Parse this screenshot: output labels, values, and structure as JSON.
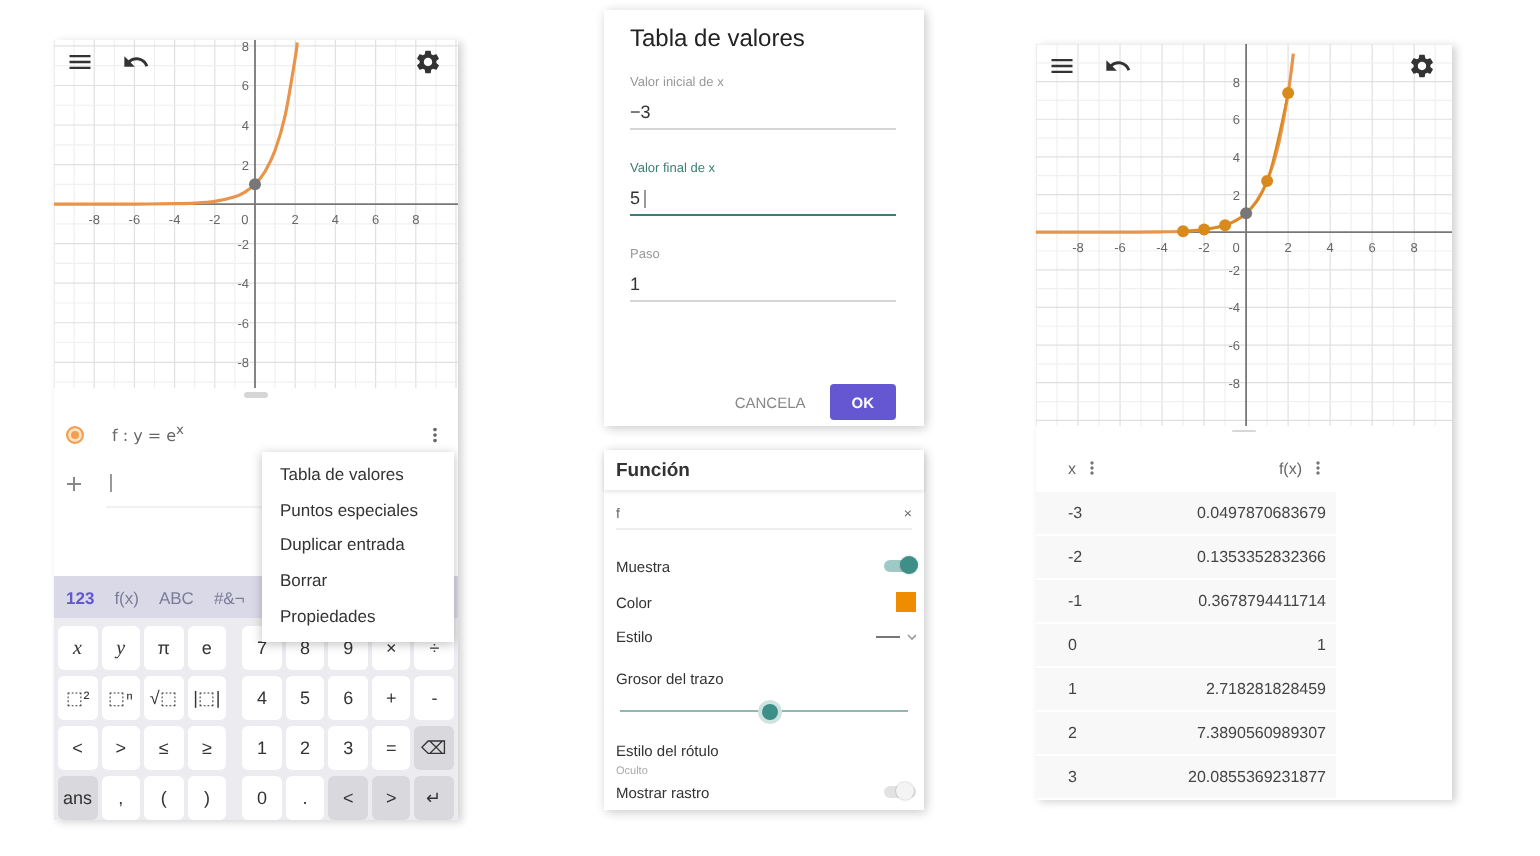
{
  "graphing_app": {
    "graph": {
      "origin_label": "0",
      "chart_data": {
        "type": "line",
        "xlim": [
          -10,
          10.1
        ],
        "ylim": [
          -9.3,
          8.3
        ],
        "x": [
          -10,
          -8,
          -6,
          -4,
          -3,
          -2,
          -1,
          -0.5,
          0,
          0.5,
          1,
          1.5,
          2,
          2.1
        ],
        "series": [
          {
            "color": "#e8944a",
            "values": [
              0,
              0,
              0,
              0.02,
              0.05,
              0.14,
              0.37,
              0.61,
              1,
              1.65,
              2.72,
              4.48,
              7.39,
              8.17
            ]
          }
        ],
        "xticks": [
          -8,
          -6,
          -4,
          -2,
          2,
          4,
          6,
          8
        ],
        "yticks": [
          -8,
          -6,
          -4,
          -2,
          2,
          4,
          6,
          8
        ],
        "grid": true
      }
    },
    "algebra": {
      "entries": [
        {
          "text": "f : y = e$^{x}$",
          "color": "#f0a050"
        }
      ]
    },
    "context_menu": {
      "items": [
        "Tabla de valores",
        "Puntos especiales",
        "Duplicar entrada",
        "Borrar",
        "Propiedades"
      ]
    },
    "keyboard": {
      "tabs": [
        {
          "label": "123",
          "selected": true
        },
        {
          "label": "f(x)",
          "selected": false
        },
        {
          "label": "ABC",
          "selected": false
        },
        {
          "label": "#&¬",
          "selected": false
        }
      ],
      "rows": [
        [
          {
            "label": "x",
            "kind": "var"
          },
          {
            "label": "y",
            "kind": "var"
          },
          {
            "label": "π",
            "kind": "key"
          },
          {
            "label": "e",
            "kind": "key"
          },
          {
            "label": "7",
            "kind": "key"
          },
          {
            "label": "8",
            "kind": "key"
          },
          {
            "label": "9",
            "kind": "key"
          },
          {
            "label": "×",
            "kind": "key"
          },
          {
            "label": "÷",
            "kind": "key"
          }
        ],
        [
          {
            "label": "⬚²",
            "kind": "key"
          },
          {
            "label": "⬚ⁿ",
            "kind": "key"
          },
          {
            "label": "√⬚",
            "kind": "key"
          },
          {
            "label": "|⬚|",
            "kind": "key"
          },
          {
            "label": "4",
            "kind": "key"
          },
          {
            "label": "5",
            "kind": "key"
          },
          {
            "label": "6",
            "kind": "key"
          },
          {
            "label": "+",
            "kind": "key"
          },
          {
            "label": "-",
            "kind": "key"
          }
        ],
        [
          {
            "label": "<",
            "kind": "key"
          },
          {
            "label": ">",
            "kind": "key"
          },
          {
            "label": "≤",
            "kind": "key"
          },
          {
            "label": "≥",
            "kind": "key"
          },
          {
            "label": "1",
            "kind": "key"
          },
          {
            "label": "2",
            "kind": "key"
          },
          {
            "label": "3",
            "kind": "key"
          },
          {
            "label": "=",
            "kind": "key"
          },
          {
            "label": "⌫",
            "kind": "fn"
          }
        ],
        [
          {
            "label": "ans",
            "kind": "fn"
          },
          {
            "label": ",",
            "kind": "key"
          },
          {
            "label": "(",
            "kind": "key"
          },
          {
            "label": ")",
            "kind": "key"
          },
          {
            "label": "0",
            "kind": "key"
          },
          {
            "label": ".",
            "kind": "key"
          },
          {
            "label": "<",
            "kind": "fn"
          },
          {
            "label": ">",
            "kind": "fn"
          },
          {
            "label": "↵",
            "kind": "fn"
          }
        ]
      ]
    }
  },
  "table_dialog": {
    "title": "Tabla de valores",
    "fields": [
      {
        "label": "Valor inicial de x",
        "value": "−3",
        "focused": false
      },
      {
        "label": "Valor final de x",
        "value": "5",
        "focused": true
      },
      {
        "label": "Paso",
        "value": "1",
        "focused": false
      }
    ],
    "buttons": [
      {
        "label": "CANCELA",
        "kind": "text"
      },
      {
        "label": "OK",
        "kind": "primary"
      }
    ]
  },
  "properties": {
    "title": "Función",
    "name_field": {
      "value": "f",
      "clear": "×"
    },
    "rows": [
      {
        "kind": "toggle",
        "label": "Muestra",
        "on": true
      },
      {
        "kind": "color",
        "label": "Color",
        "color": "#f08c00"
      },
      {
        "kind": "style",
        "label": "Estilo"
      },
      {
        "kind": "slider",
        "label": "Grosor del trazo",
        "level": 0.52
      },
      {
        "kind": "select",
        "label": "Estilo del rótulo",
        "value": "Oculto"
      },
      {
        "kind": "toggle",
        "label": "Mostrar rastro",
        "on": false
      }
    ]
  },
  "table_view": {
    "graph": {
      "origin_label": "0",
      "chart_data": {
        "type": "line",
        "xlim": [
          -10,
          9.8
        ],
        "ylim": [
          -10.3,
          10
        ],
        "x": [
          -10,
          -8,
          -6,
          -4,
          -3,
          -2,
          -1,
          -0.5,
          0,
          0.5,
          1,
          1.5,
          2,
          2.25
        ],
        "series": [
          {
            "color": "#e8944a",
            "values": [
              0,
              0,
              0,
              0.02,
              0.05,
              0.14,
              0.37,
              0.61,
              1,
              1.65,
              2.72,
              4.48,
              7.39,
              9.49
            ]
          },
          {
            "color": "#d98a1c",
            "marker": true,
            "values": [
              null,
              null,
              null,
              null,
              0.05,
              0.14,
              0.37,
              null,
              1,
              null,
              2.72,
              null,
              7.39,
              null
            ]
          }
        ],
        "xticks": [
          -8,
          -6,
          -4,
          -2,
          2,
          4,
          6,
          8
        ],
        "yticks": [
          -8,
          -6,
          -4,
          -2,
          2,
          4,
          6,
          8
        ],
        "grid": true
      }
    },
    "columns": [
      {
        "label": "x"
      },
      {
        "label": "f(x)"
      }
    ],
    "rows": [
      [
        "-3",
        "0.0497870683679"
      ],
      [
        "-2",
        "0.1353352832366"
      ],
      [
        "-1",
        "0.3678794411714"
      ],
      [
        "0",
        "1"
      ],
      [
        "1",
        "2.718281828459"
      ],
      [
        "2",
        "7.3890560989307"
      ],
      [
        "3",
        "20.0855369231877"
      ]
    ]
  }
}
